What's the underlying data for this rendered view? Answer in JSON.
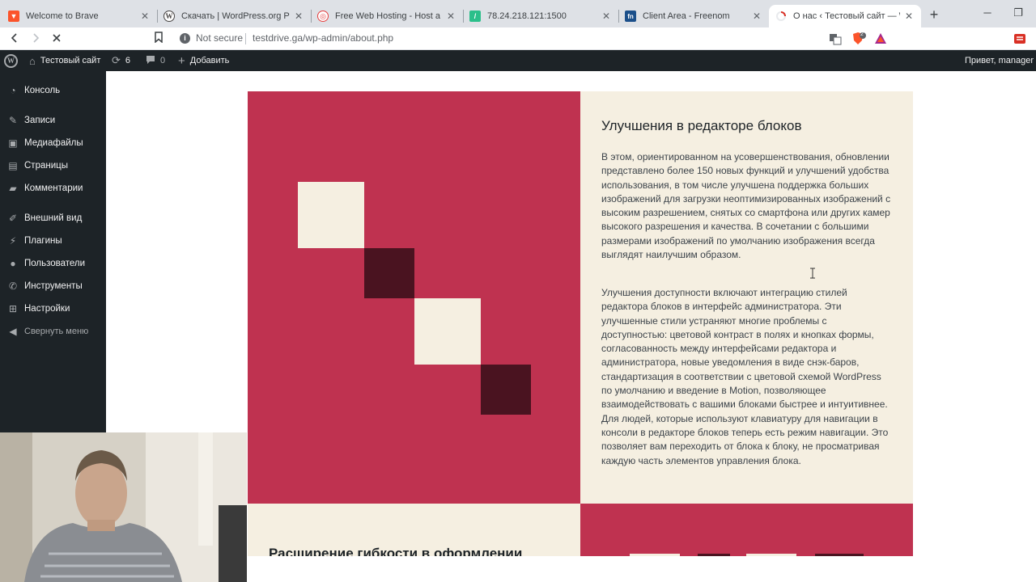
{
  "browser": {
    "tabs": [
      {
        "title": "Welcome to Brave",
        "favicon": "brave-icon",
        "active": false
      },
      {
        "title": "Скачать | WordPress.org Русский",
        "favicon": "wordpress-icon",
        "active": false
      },
      {
        "title": "Free Web Hosting - Host a Website",
        "favicon": "000webhost-icon",
        "active": false
      },
      {
        "title": "78.24.218.121:1500",
        "favicon": "ispmanager-icon",
        "active": false
      },
      {
        "title": "Client Area - Freenom",
        "favicon": "freenom-icon",
        "active": false
      },
      {
        "title": "О нас ‹ Тестовый сайт — WordPress",
        "favicon": "loading-spinner-icon",
        "active": true
      }
    ],
    "address": {
      "security_label": "Not secure",
      "url": "testdrive.ga/wp-admin/about.php"
    },
    "brave_shield_count": "2"
  },
  "adminbar": {
    "site_name": "Тестовый сайт",
    "updates_count": "6",
    "comments_count": "0",
    "add_new_label": "Добавить",
    "greeting": "Привет, manager"
  },
  "sidebar": {
    "items": [
      {
        "label": "Консоль",
        "icon": "dashboard-icon"
      },
      {
        "label": "Записи",
        "icon": "pin-icon"
      },
      {
        "label": "Медиафайлы",
        "icon": "media-icon"
      },
      {
        "label": "Страницы",
        "icon": "page-icon"
      },
      {
        "label": "Комментарии",
        "icon": "comment-icon"
      },
      {
        "label": "Внешний вид",
        "icon": "brush-icon"
      },
      {
        "label": "Плагины",
        "icon": "plugin-icon"
      },
      {
        "label": "Пользователи",
        "icon": "users-icon"
      },
      {
        "label": "Инструменты",
        "icon": "wrench-icon"
      },
      {
        "label": "Настройки",
        "icon": "settings-icon"
      }
    ],
    "collapse_label": "Свернуть меню"
  },
  "feature": {
    "heading": "Улучшения в редакторе блоков",
    "paragraph1": "В этом, ориентированном на усовершенствования, обновлении представлено более 150 новых функций и улучшений удобства использования, в том числе улучшена поддержка больших изображений для загрузки неоптимизированных изображений с высоким разрешением, снятых со смартфона или других камер высокого разрешения и качества. В сочетании с большими размерами изображений по умолчанию изображения всегда выглядят наилучшим образом.",
    "paragraph2": "Улучшения доступности включают интеграцию стилей редактора блоков в интерфейс администратора. Эти улучшенные стили устраняют многие проблемы с доступностью: цветовой контраст в полях и кнопках формы, согласованность между интерфейсами редактора и администратора, новые уведомления в виде снэк-баров, стандартизация в соответствии с цветовой схемой WordPress по умолчанию и введение в Motion, позволяющее взаимодействовать с вашими блоками быстрее и интуитивнее. Для людей, которые используют клавиатуру для навигации в консоли в редакторе блоков теперь есть режим навигации. Это позволяет вам переходить от блока к блоку, не просматривая каждую часть элементов управления блока.",
    "next_heading": "Расширение гибкости в оформлении"
  },
  "colors": {
    "accent_red": "#bf3250",
    "cream": "#f5efe1",
    "dark_square": "#4a1320",
    "admin_dark": "#1d2327"
  }
}
